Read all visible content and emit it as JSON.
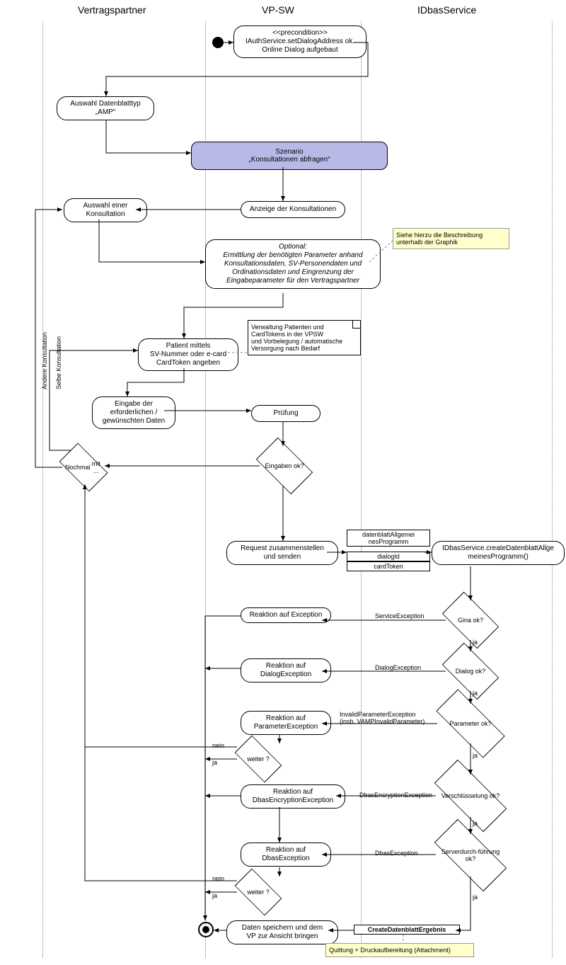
{
  "lanes": {
    "a": "Vertragspartner",
    "b": "VP-SW",
    "c": "IDbasService"
  },
  "nodes": {
    "precond": {
      "t": "<<precondition>>",
      "l1": "IAuthService.setDialogAddress ok.",
      "l2": "Online Dialog aufgebaut"
    },
    "amp": {
      "l1": "Auswahl Datenblatttyp",
      "l2": "„AMP“"
    },
    "szenario": {
      "l1": "Szenario",
      "l2": "„Konsultationen abfragen“"
    },
    "anzeige": "Anzeige der Konsultationen",
    "auswahl": "Auswahl einer Konsultation",
    "optional": {
      "t": "Optional:",
      "l1": "Ermittlung der benötigten Parameter anhand",
      "l2": "Konsultationsdaten, SV-Personendaten und",
      "l3": "Ordinationsdaten und Eingrenzung der",
      "l4": "Eingabeparameter für den Vertragspartner"
    },
    "patient": {
      "l1": "Patient mittels",
      "l2": "SV-Nummer oder e-card",
      "l3": "CardToken angeben"
    },
    "eingabe": {
      "l1": "Eingabe der",
      "l2": "erforderlichen /",
      "l3": "gewünschten Daten"
    },
    "verwaltung": {
      "l1": "Verwaltung Patienten und",
      "l2": "CardTokens in der VPSW",
      "l3": "und Vorbelegung / automatische",
      "l4": "Versorgung nach Bedarf"
    },
    "pruefung": "Prüfung",
    "eingabenok": "Eingaben ok?",
    "nochmal": {
      "l1": "Nochmal",
      "l2": "mit ..."
    },
    "request": {
      "l1": "Request zusammenstellen",
      "l2": "und senden"
    },
    "params": {
      "p1": "datenblattAllgemei",
      "p1b": "nesProgramm",
      "p2": "dialogId",
      "p3": "cardToken"
    },
    "svc": {
      "l1": "IDbasService.createDatenblattAllge",
      "l2": "meinesProgramm()"
    },
    "rex": "Reaktion auf Exception",
    "rdlg": "Reaktion auf DialogException",
    "rparam": "Reaktion auf ParameterException",
    "renc": "Reaktion auf DbasEncryptionException",
    "rdbas": "Reaktion auf DbasException",
    "ginaok": "Gina ok?",
    "dlgok": "Dialog ok?",
    "paramok": "Parameter ok?",
    "encok": "Verschlüsselung ok?",
    "srvok": "Serverdurch-führung ok?",
    "weiter": "weiter ?",
    "save": {
      "l1": "Daten speichern und dem",
      "l2": "VP zur Ansicht bringen"
    },
    "result": "CreateDatenblattErgebnis",
    "noteBeschr": {
      "l1": "Siehe hierzu die Beschreibung",
      "l2": "unterhalb der Graphik"
    },
    "noteQuit": "Quittung + Druckaufbereitung (Attachment)"
  },
  "labels": {
    "ja": "ja",
    "nein": "nein",
    "selbeK": "Selbe Konsultation",
    "andereK": "Andere Konsultation",
    "svcEx": "ServiceException",
    "dlgEx": "DialogException",
    "invParam": {
      "l1": "InvalidParameterException",
      "l2": "(insb. VAMPInvalidParameter)"
    },
    "encEx": "DbasEncryptionException",
    "dbasEx": "DbasException"
  }
}
